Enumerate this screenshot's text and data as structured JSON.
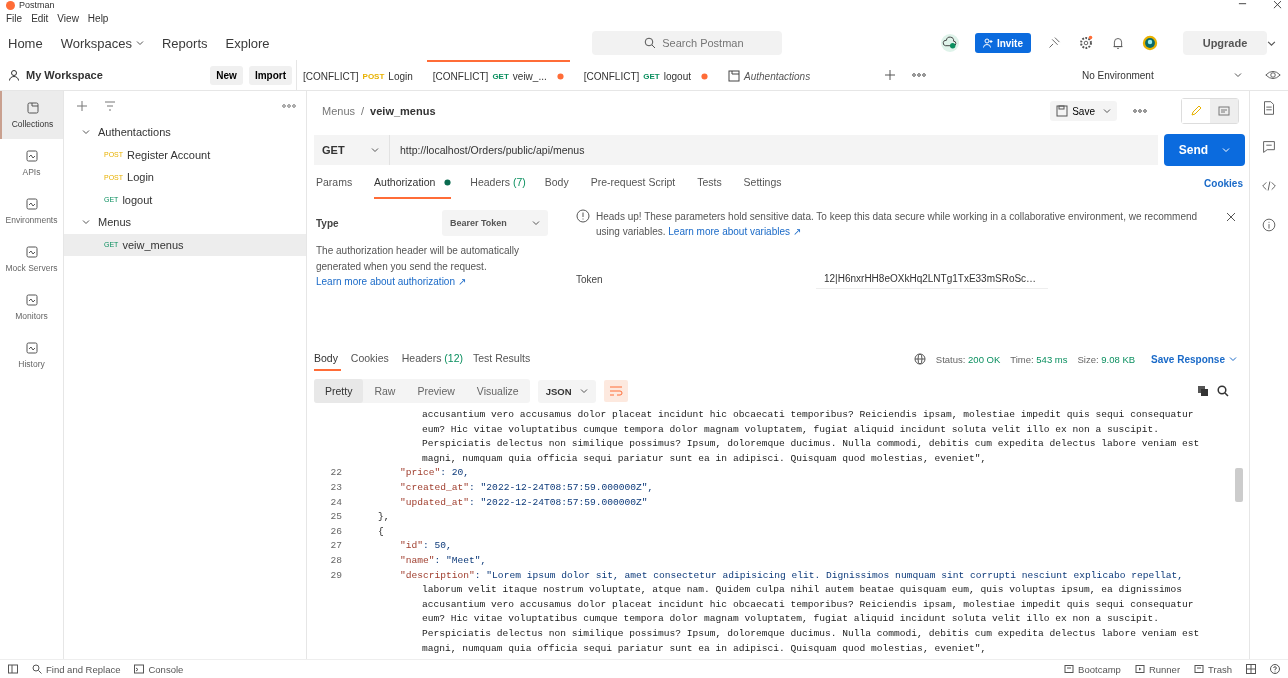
{
  "window": {
    "title": "Postman"
  },
  "menu": [
    "File",
    "Edit",
    "View",
    "Help"
  ],
  "nav": [
    {
      "label": "Home",
      "has_caret": false
    },
    {
      "label": "Workspaces",
      "has_caret": true
    },
    {
      "label": "Reports",
      "has_caret": false
    },
    {
      "label": "Explore",
      "has_caret": false
    }
  ],
  "search": {
    "placeholder": "Search Postman"
  },
  "invite": "Invite",
  "upgrade": "Upgrade",
  "workspace": {
    "name": "My Workspace",
    "buttons": [
      "New",
      "Import"
    ]
  },
  "tabs": [
    {
      "kind": "request",
      "prefix": "[CONFLICT]",
      "method": "POST",
      "name": "Login",
      "selected": false,
      "unsaved": false
    },
    {
      "kind": "request",
      "prefix": "[CONFLICT]",
      "method": "GET",
      "name": "veiw_...",
      "selected": true,
      "unsaved": true
    },
    {
      "kind": "request",
      "prefix": "[CONFLICT]",
      "method": "GET",
      "name": "logout",
      "selected": false,
      "unsaved": true
    },
    {
      "kind": "collection",
      "name": "Authentactions",
      "selected": false
    }
  ],
  "environment": "No Environment",
  "rail": [
    {
      "label": "Collections",
      "selected": true
    },
    {
      "label": "APIs",
      "selected": false
    },
    {
      "label": "Environments",
      "selected": false
    },
    {
      "label": "Mock Servers",
      "selected": false
    },
    {
      "label": "Monitors",
      "selected": false
    },
    {
      "label": "History",
      "selected": false
    }
  ],
  "tree": [
    {
      "name": "Authentactions",
      "expanded": true,
      "children": [
        {
          "method": "POST",
          "name": "Register Account",
          "selected": false
        },
        {
          "method": "POST",
          "name": "Login",
          "selected": false
        },
        {
          "method": "GET",
          "name": "logout",
          "selected": false
        }
      ]
    },
    {
      "name": "Menus",
      "expanded": true,
      "children": [
        {
          "method": "GET",
          "name": "veiw_menus",
          "selected": true
        }
      ]
    }
  ],
  "breadcrumb": [
    "Menus",
    "veiw_menus"
  ],
  "breadcrumb_separator": "/",
  "save": "Save",
  "edit_mode": true,
  "request": {
    "method": "GET",
    "url": "http://localhost/Orders/public/api/menus",
    "send": "Send"
  },
  "request_tabs": [
    {
      "label": "Params",
      "dot": false,
      "selected": false
    },
    {
      "label": "Authorization",
      "dot": true,
      "selected": true
    },
    {
      "label": "Headers",
      "count": "(7)",
      "dot": false,
      "selected": false
    },
    {
      "label": "Body",
      "dot": false,
      "selected": false
    },
    {
      "label": "Pre-request Script",
      "dot": false,
      "selected": false
    },
    {
      "label": "Tests",
      "dot": false,
      "selected": false
    },
    {
      "label": "Settings",
      "dot": false,
      "selected": false
    }
  ],
  "cookies": "Cookies",
  "auth": {
    "type_label": "Type",
    "type_value": "Bearer Token",
    "note": "The authorization header will be automatically generated when you send the request.",
    "note_link": "Learn more about authorization ↗",
    "alert": "Heads up! These parameters hold sensitive data. To keep this data secure while working in a collaborative environment, we recommend using variables.",
    "alert_link": "Learn more about variables ↗",
    "token_label": "Token",
    "token_value": "12|H6nxrHH8eOXkHq2LNTg1TxE33mSRoSc…"
  },
  "response_tabs": [
    {
      "label": "Body",
      "selected": true
    },
    {
      "label": "Cookies",
      "selected": false
    },
    {
      "label": "Headers",
      "count": "(12)",
      "selected": false
    },
    {
      "label": "Test Results",
      "selected": false
    }
  ],
  "stats": [
    {
      "label": "Status:",
      "value": "200 OK"
    },
    {
      "label": "Time:",
      "value": "543 ms"
    },
    {
      "label": "Size:",
      "value": "9.08 KB"
    }
  ],
  "save_response": "Save Response",
  "view_modes": [
    {
      "label": "Pretty",
      "selected": true
    },
    {
      "label": "Raw",
      "selected": false
    },
    {
      "label": "Preview",
      "selected": false
    },
    {
      "label": "Visualize",
      "selected": false
    }
  ],
  "format": "JSON",
  "code": [
    {
      "kind": "wrap",
      "text": "accusantium vero accusamus dolor placeat incidunt hic obcaecati temporibus? Reiciendis ipsam, molestiae impedit quis sequi consequatur"
    },
    {
      "kind": "wrap",
      "text": "eum? Hic vitae voluptatibus cumque tempora dolor magnam voluptatem, fugiat aliquid incidunt soluta velit illo ex non a suscipit."
    },
    {
      "kind": "wrap",
      "text": "Perspiciatis delectus non similique possimus? Ipsum, doloremque ducimus. Nulla commodi, debitis cum expedita delectus labore veniam est"
    },
    {
      "kind": "wrap",
      "text": "magni, numquam quia officia sequi pariatur sunt ea in adipisci. Quisquam quod molestias, eveniet\","
    },
    {
      "kind": "key",
      "number": "22",
      "key": "\"price\"",
      "rest": ": 20,"
    },
    {
      "kind": "key",
      "number": "23",
      "key": "\"created_at\"",
      "rest": ": \"2022-12-24T08:57:59.000000Z\","
    },
    {
      "kind": "key",
      "number": "24",
      "key": "\"updated_at\"",
      "rest": ": \"2022-12-24T08:57:59.000000Z\""
    },
    {
      "kind": "brace",
      "number": "25",
      "text": "},"
    },
    {
      "kind": "brace",
      "number": "26",
      "text": "{"
    },
    {
      "kind": "key",
      "number": "27",
      "key": "\"id\"",
      "rest": ": 50,"
    },
    {
      "kind": "key",
      "number": "28",
      "key": "\"name\"",
      "rest": ": \"Meet\","
    },
    {
      "kind": "key",
      "number": "29",
      "key": "\"description\"",
      "rest": ": \"Lorem ipsum dolor sit, amet consectetur adipisicing elit. Dignissimos numquam sint corrupti nesciunt explicabo repellat,"
    },
    {
      "kind": "wrap",
      "text": "laborum velit itaque nostrum voluptate, atque nam. Quidem culpa nihil autem beatae quisquam eum, quis voluptas ipsum, ea dignissimos"
    },
    {
      "kind": "wrap",
      "text": "accusantium vero accusamus dolor placeat incidunt hic obcaecati temporibus? Reiciendis ipsam, molestiae impedit quis sequi consequatur"
    },
    {
      "kind": "wrap",
      "text": "eum? Hic vitae voluptatibus cumque tempora dolor magnam voluptatem, fugiat aliquid incidunt soluta velit illo ex non a suscipit."
    },
    {
      "kind": "wrap",
      "text": "Perspiciatis delectus non similique possimus? Ipsum, doloremque ducimus. Nulla commodi, debitis cum expedita delectus labore veniam est"
    },
    {
      "kind": "wrap",
      "text": "magni, numquam quia officia sequi pariatur sunt ea in adipisci. Quisquam quod molestias, eveniet\","
    }
  ],
  "footer_left": [
    "Find and Replace",
    "Console"
  ],
  "footer_right": [
    "Bootcamp",
    "Runner",
    "Trash"
  ]
}
